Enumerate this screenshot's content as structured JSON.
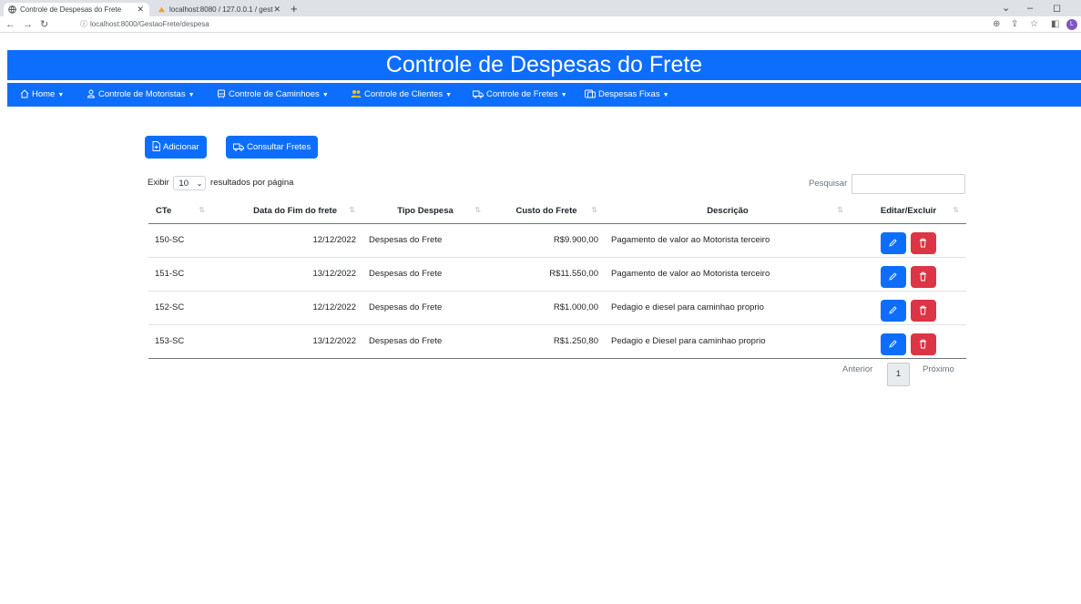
{
  "browser": {
    "tabs": [
      {
        "label": "Controle de Despesas do Frete",
        "active": true
      },
      {
        "label": "localhost:8080 / 127.0.0.1 / gest",
        "active": false
      }
    ],
    "url": "localhost:8000/GestaoFrete/despesa",
    "profile_initial": "L"
  },
  "header": {
    "title": "Controle de Despesas do Frete"
  },
  "nav": {
    "items": [
      {
        "label": "Home",
        "icon": "house-icon"
      },
      {
        "label": "Controle de Motoristas",
        "icon": "person-icon"
      },
      {
        "label": "Controle de Caminhoes",
        "icon": "truck-front-icon"
      },
      {
        "label": "Controle de Clientes",
        "icon": "people-icon"
      },
      {
        "label": "Controle de Fretes",
        "icon": "truck-icon"
      },
      {
        "label": "Despesas Fixas",
        "icon": "receipt-icon"
      }
    ]
  },
  "actions": {
    "add_label": "Adicionar",
    "query_label": "Consultar Fretes"
  },
  "table_controls": {
    "show_prefix": "Exibir",
    "page_length": "10",
    "show_suffix": "resultados por página",
    "search_label": "Pesquisar",
    "search_value": ""
  },
  "table": {
    "columns": [
      "CTe",
      "Data do Fim do frete",
      "Tipo Despesa",
      "Custo do Frete",
      "Descrição",
      "Editar/Excluir"
    ],
    "rows": [
      {
        "cte": "150-SC",
        "date": "12/12/2022",
        "type": "Despesas do Frete",
        "cost": "R$9.900,00",
        "desc": "Pagamento de valor ao Motorista terceiro"
      },
      {
        "cte": "151-SC",
        "date": "13/12/2022",
        "type": "Despesas do Frete",
        "cost": "R$11.550,00",
        "desc": "Pagamento de valor ao Motorista terceiro"
      },
      {
        "cte": "152-SC",
        "date": "12/12/2022",
        "type": "Despesas do Frete",
        "cost": "R$1.000,00",
        "desc": "Pedagio e diesel para caminhao proprio"
      },
      {
        "cte": "153-SC",
        "date": "13/12/2022",
        "type": "Despesas do Frete",
        "cost": "R$1.250,80",
        "desc": "Pedagio e Diesel para caminhao proprio"
      }
    ]
  },
  "pagination": {
    "prev": "Anterior",
    "current": "1",
    "next": "Próximo"
  },
  "colors": {
    "primary": "#0d6efd",
    "danger": "#dc3545"
  }
}
